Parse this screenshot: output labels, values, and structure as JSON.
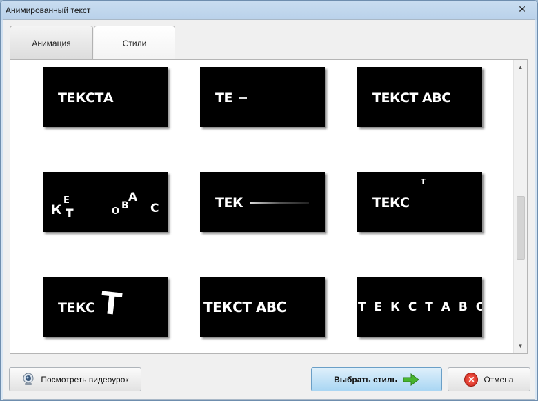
{
  "window": {
    "title": "Анимированный текст",
    "close_glyph": "✕"
  },
  "tabs": [
    {
      "label": "Анимация",
      "active": true
    },
    {
      "label": "Стили",
      "active": false
    }
  ],
  "thumbnails": [
    {
      "id": "style-1",
      "text": "ТЕКСТА"
    },
    {
      "id": "style-2",
      "text": "ТЕ"
    },
    {
      "id": "style-3",
      "text": "ТЕКСТ АВС"
    },
    {
      "id": "style-4",
      "fragments": [
        "К",
        "Е",
        "Т",
        "О",
        "В",
        "А",
        "С"
      ]
    },
    {
      "id": "style-5",
      "text": "ТЕК"
    },
    {
      "id": "style-6",
      "text": "ТЕКС",
      "extra": "Т"
    },
    {
      "id": "style-7",
      "text": "ТЕКС",
      "extra": "Т"
    },
    {
      "id": "style-8",
      "text": "ТЕКСТ АВС"
    },
    {
      "id": "style-9",
      "text": "Т Е К С Т   А В С"
    }
  ],
  "scrollbar": {
    "up_glyph": "▲",
    "down_glyph": "▼"
  },
  "buttons": {
    "video": {
      "label": "Посмотреть видеоурок",
      "icon": "webcam-icon"
    },
    "select": {
      "label": "Выбрать стиль",
      "icon": "green-arrow-icon",
      "accent": "#3fa82c"
    },
    "cancel": {
      "label": "Отмена",
      "icon": "cancel-icon",
      "glyph": "✕",
      "accent": "#d0271b"
    }
  }
}
